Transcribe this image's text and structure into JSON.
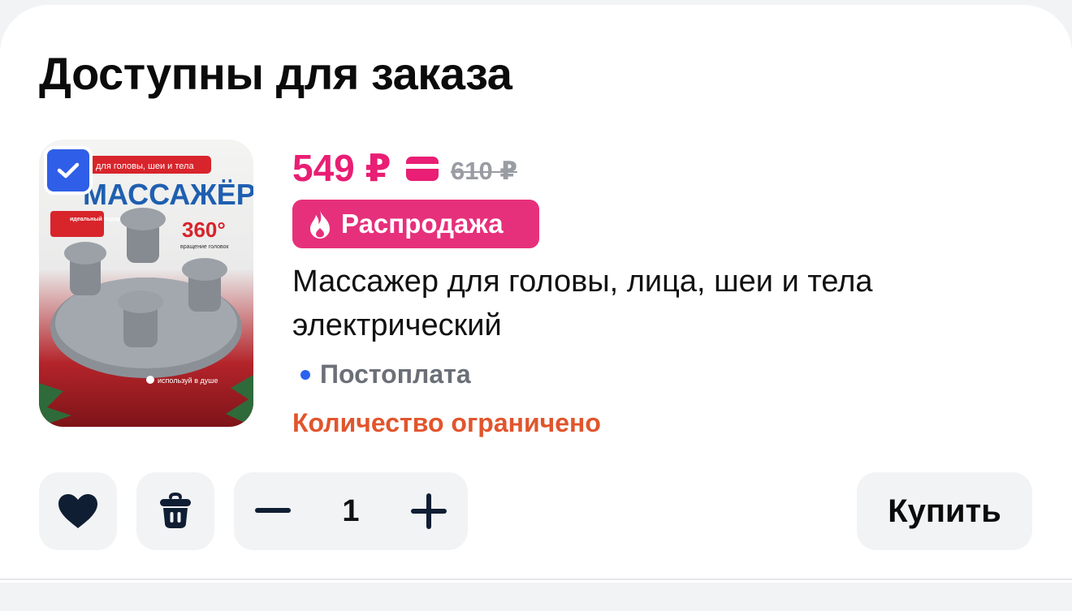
{
  "section": {
    "title": "Доступны для заказа"
  },
  "product": {
    "selected": true,
    "image_texts": {
      "ribbon": "для головы, шеи и тела",
      "heading": "МАССАЖЁР",
      "gift": "идеальный подарок",
      "degrees": "360°",
      "rotation": "вращение головок",
      "shower": "используй в душе"
    },
    "price": "549 ₽",
    "old_price": "610 ₽",
    "badge": "Распродажа",
    "title": "Массажер для головы, лица, шеи и тела электрический",
    "payment": "Постоплата",
    "stock_note": "Количество ограничено"
  },
  "actions": {
    "quantity": "1",
    "buy_label": "Купить"
  },
  "icons": {
    "favorite": "heart-icon",
    "delete": "trash-icon",
    "decrease": "minus-icon",
    "increase": "plus-icon",
    "card": "card-icon",
    "flame": "flame-icon",
    "check": "check-icon"
  },
  "colors": {
    "price": "#e91e74",
    "badge": "#e6307b",
    "checkbox": "#2f5fe8",
    "stock_note": "#e1552d",
    "old_price": "#9a9ca3"
  }
}
